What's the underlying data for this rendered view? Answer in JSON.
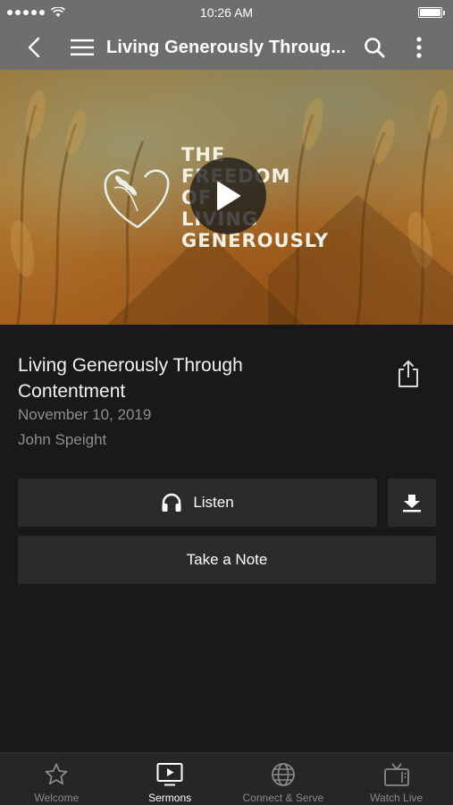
{
  "status_bar": {
    "time": "10:26 AM"
  },
  "nav": {
    "title": "Living Generously Throug..."
  },
  "hero": {
    "title_lines": [
      "THE",
      "FREEDOM",
      "OF",
      "LIVING",
      "GENEROUSLY"
    ]
  },
  "sermon": {
    "title": "Living Generously Through Contentment",
    "date": "November 10, 2019",
    "speaker": "John Speight"
  },
  "actions": {
    "listen_label": "Listen",
    "note_label": "Take a Note"
  },
  "tabs": [
    {
      "label": "Welcome",
      "icon": "star-icon",
      "active": false
    },
    {
      "label": "Sermons",
      "icon": "play-screen-icon",
      "active": true
    },
    {
      "label": "Connect & Serve",
      "icon": "globe-icon",
      "active": false
    },
    {
      "label": "Watch Live",
      "icon": "tv-icon",
      "active": false
    }
  ],
  "colors": {
    "header": "#6e6e6e",
    "background": "#18191b",
    "button": "#2b2b2d",
    "muted_text": "#8e8e8e",
    "tab_bar": "#262628"
  }
}
